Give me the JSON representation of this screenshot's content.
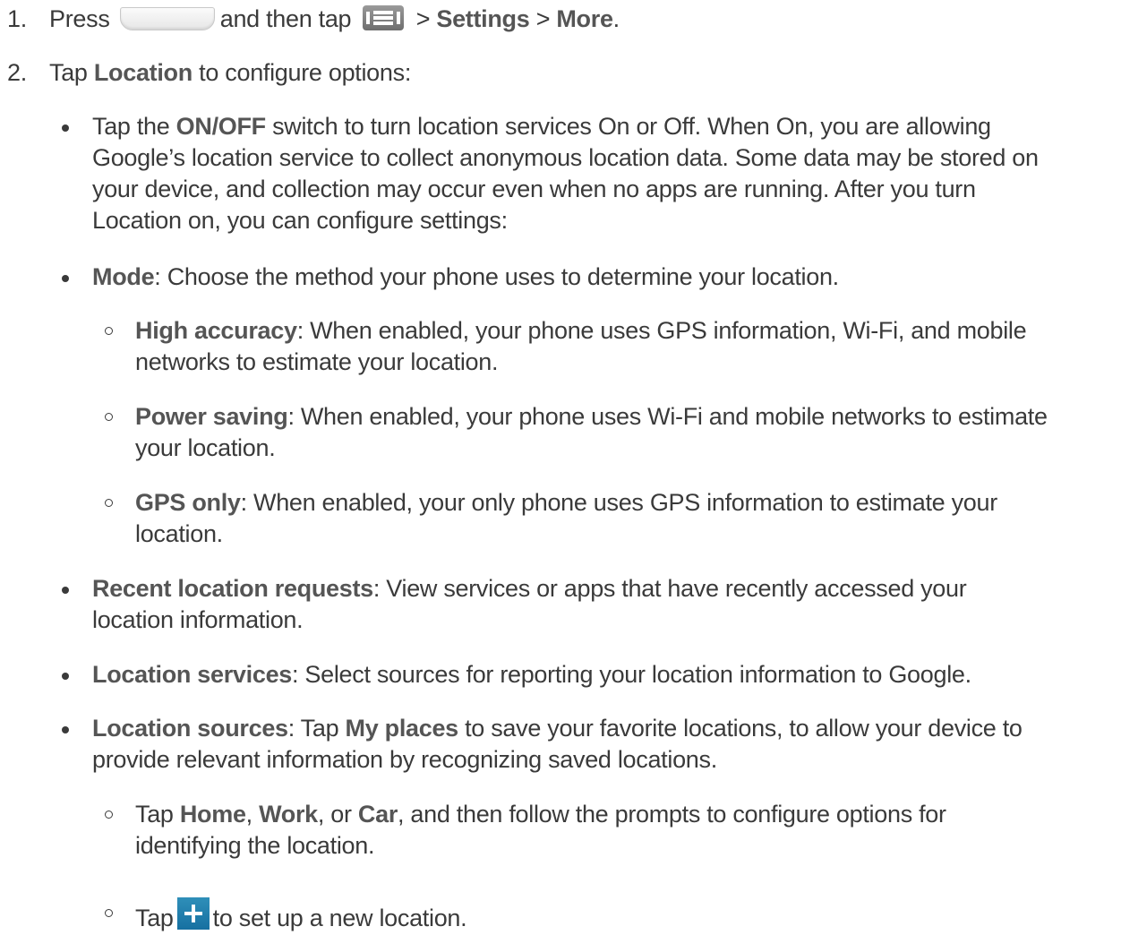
{
  "steps": [
    {
      "number": "1.",
      "press": "Press",
      "and_then_tap": "and then tap",
      "sep1": ">",
      "settings": "Settings",
      "sep2": ">",
      "more": "More",
      "period": "."
    },
    {
      "number": "2.",
      "tap": "Tap",
      "location": "Location",
      "rest": "to configure options:"
    }
  ],
  "bullets": {
    "onoff": {
      "tap_the": "Tap the",
      "term": "ON/OFF",
      "line1_rest": "switch to turn location services On or Off. When On, you are allowing",
      "line2": "Google’s location service to collect anonymous location data. Some data may be stored on",
      "line3": "your device, and collection may occur even when no apps are running. After you turn",
      "line4": "Location on, you can configure settings:"
    },
    "mode": {
      "term": "Mode",
      "text": ": Choose the method your phone uses to determine your location."
    },
    "recent": {
      "term": "Recent location requests",
      "line1_rest": ": View services or apps that have recently accessed your",
      "line2": "location information."
    },
    "services": {
      "term": "Location services",
      "text": ": Select sources for reporting your location information to Google."
    },
    "sources": {
      "term": "Location sources",
      "mid": ": Tap",
      "myplaces": "My places",
      "line1_rest": "to save your favorite locations, to allow your device to",
      "line2": "provide relevant information by recognizing saved locations."
    }
  },
  "subbullets": {
    "high": {
      "term": "High accuracy",
      "line1_rest": ": When enabled, your phone uses GPS information, Wi-Fi, and mobile",
      "line2": "networks to estimate your location."
    },
    "power": {
      "term": "Power saving",
      "line1_rest": ": When enabled, your phone uses Wi-Fi and mobile networks to estimate",
      "line2": "your location."
    },
    "gps": {
      "term": "GPS only",
      "line1_rest": ": When enabled, your only phone uses GPS information to estimate your",
      "line2": "location."
    },
    "homework": {
      "tap": "Tap",
      "home": "Home",
      "comma1": ",",
      "work": "Work",
      "or": ", or",
      "car": "Car",
      "line1_rest": ", and then follow the prompts to configure options for",
      "line2": "identifying the location."
    },
    "newloc": {
      "tap": "Tap",
      "rest": "to set up a new location."
    }
  },
  "icons": {
    "home_button": "home-button-icon",
    "menu": "menu-icon",
    "add": "plus-icon",
    "add_color": "#1f7fb0"
  }
}
